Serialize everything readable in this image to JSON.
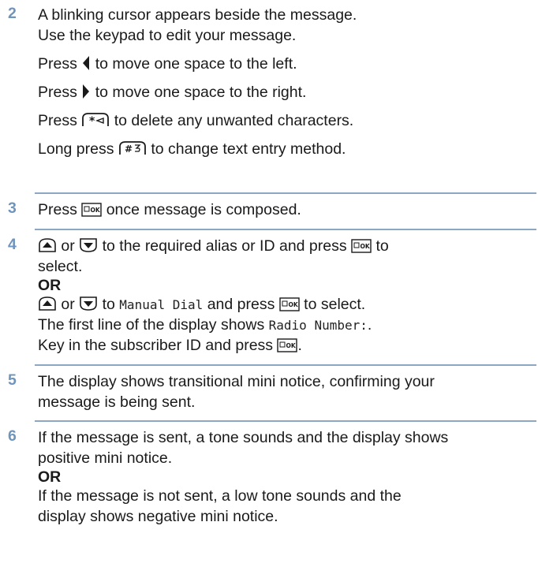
{
  "steps": [
    {
      "number": "2",
      "lines": {
        "l1": "A blinking cursor appears beside the message.",
        "l2": "Use the keypad to edit your message.",
        "l3_pre": "Press",
        "l3_post": "to move one space to the left.",
        "l4_pre": "Press",
        "l4_post": "to move one space to the right.",
        "l5_pre": "Press",
        "l5_post": "to delete any unwanted characters.",
        "l6_pre": "Long press",
        "l6_post": "to change text entry method."
      }
    },
    {
      "number": "3",
      "lines": {
        "pre": "Press",
        "post": "once message is composed."
      }
    },
    {
      "number": "4",
      "lines": {
        "or_word": "or",
        "l1_mid": "to the required alias or ID and press",
        "l1_post": "to",
        "l2": "select.",
        "or_label": "OR",
        "l4_mid": "to",
        "l4_mono": "Manual Dial",
        "l4_post": "and press",
        "l4_end": "to select.",
        "l5_pre": "The first line of the display shows",
        "l5_mono": "Radio Number:",
        "l5_end": ".",
        "l6_pre": "Key in the subscriber ID and press",
        "l6_end": "."
      }
    },
    {
      "number": "5",
      "lines": {
        "l1": "The display shows transitional mini notice, confirming your",
        "l2": "message is being sent."
      }
    },
    {
      "number": "6",
      "lines": {
        "l1": "If the message is sent, a tone sounds and the display shows",
        "l2": "positive mini notice.",
        "or_label": "OR",
        "l4": "If the message is not sent, a low tone sounds and the",
        "l5": "display shows negative mini notice."
      }
    }
  ],
  "icons": {
    "left": "left-arrow-key-icon",
    "right": "right-arrow-key-icon",
    "star": "star-delete-key-icon",
    "hash": "hash-key-icon",
    "menu_ok": "menu-ok-key-icon",
    "up": "up-navigation-key-icon",
    "down": "down-navigation-key-icon"
  },
  "key_glyphs": {
    "star": "*",
    "hash": "#",
    "ok": "OK"
  },
  "colors": {
    "step_number": "#6f95bd",
    "separator": "#8da7c2",
    "text": "#1a1a1a"
  }
}
